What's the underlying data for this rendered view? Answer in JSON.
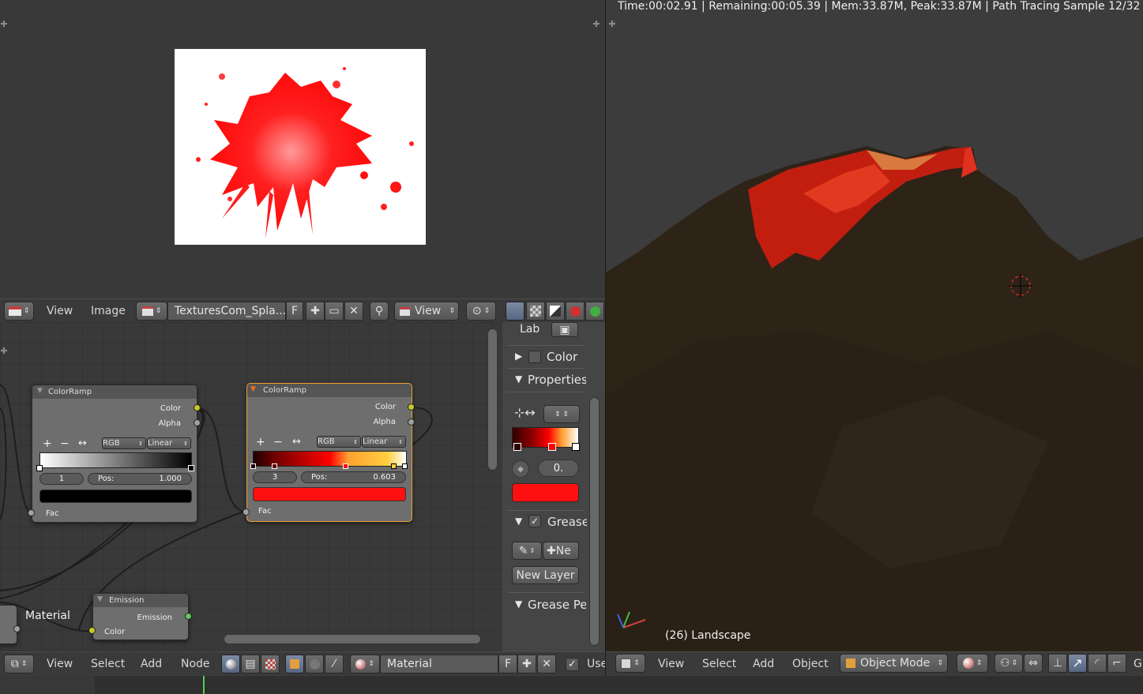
{
  "image_editor": {
    "header": {
      "menus": [
        "View",
        "Image"
      ],
      "image_name": "TexturesCom_Spla...",
      "fake_user": "F",
      "view_select": "View"
    }
  },
  "node_editor": {
    "nodes": [
      {
        "title": "ColorRamp",
        "out_color": "Color",
        "out_alpha": "Alpha",
        "plus": "+",
        "minus": "−",
        "flip": "↔",
        "mode": "RGB",
        "interp": "Linear",
        "index": "1",
        "pos_label": "Pos:",
        "pos": "1.000",
        "in_fac": "Fac"
      },
      {
        "title": "ColorRamp",
        "out_color": "Color",
        "out_alpha": "Alpha",
        "plus": "+",
        "minus": "−",
        "flip": "↔",
        "mode": "RGB",
        "interp": "Linear",
        "index": "3",
        "pos_label": "Pos:",
        "pos": "0.603",
        "in_fac": "Fac"
      },
      {
        "title": "Emission",
        "out": "Emission",
        "in_color": "Color"
      }
    ],
    "frame_label": "Material",
    "header": {
      "menus": [
        "View",
        "Select",
        "Add",
        "Node"
      ],
      "material": "Material",
      "fake_user": "F",
      "use_nodes": "Use"
    }
  },
  "properties_panel": {
    "lab_label": "Lab",
    "sections": [
      {
        "label": "Color",
        "expanded": false
      },
      {
        "label": "Properties",
        "expanded": true
      },
      {
        "label": "Grease",
        "expanded": true
      },
      {
        "label": "Grease Pe",
        "expanded": true
      }
    ],
    "index_value": "0.",
    "new_button": "Ne",
    "new_layer": "New Layer"
  },
  "viewport": {
    "status": "Time:00:02.91 | Remaining:00:05.39 | Mem:33.87M, Peak:33.87M | Path Tracing Sample 12/32",
    "object_label": "(26) Landscape",
    "header": {
      "menus": [
        "View",
        "Select",
        "Add",
        "Object"
      ],
      "mode": "Object Mode",
      "tail": "G"
    }
  },
  "colors": {
    "accent_red": "#ff1010",
    "node_active_border": "#f0a030",
    "socket_yellow": "#c8c820",
    "socket_grey": "#a0a0a0",
    "socket_green": "#60c860"
  }
}
